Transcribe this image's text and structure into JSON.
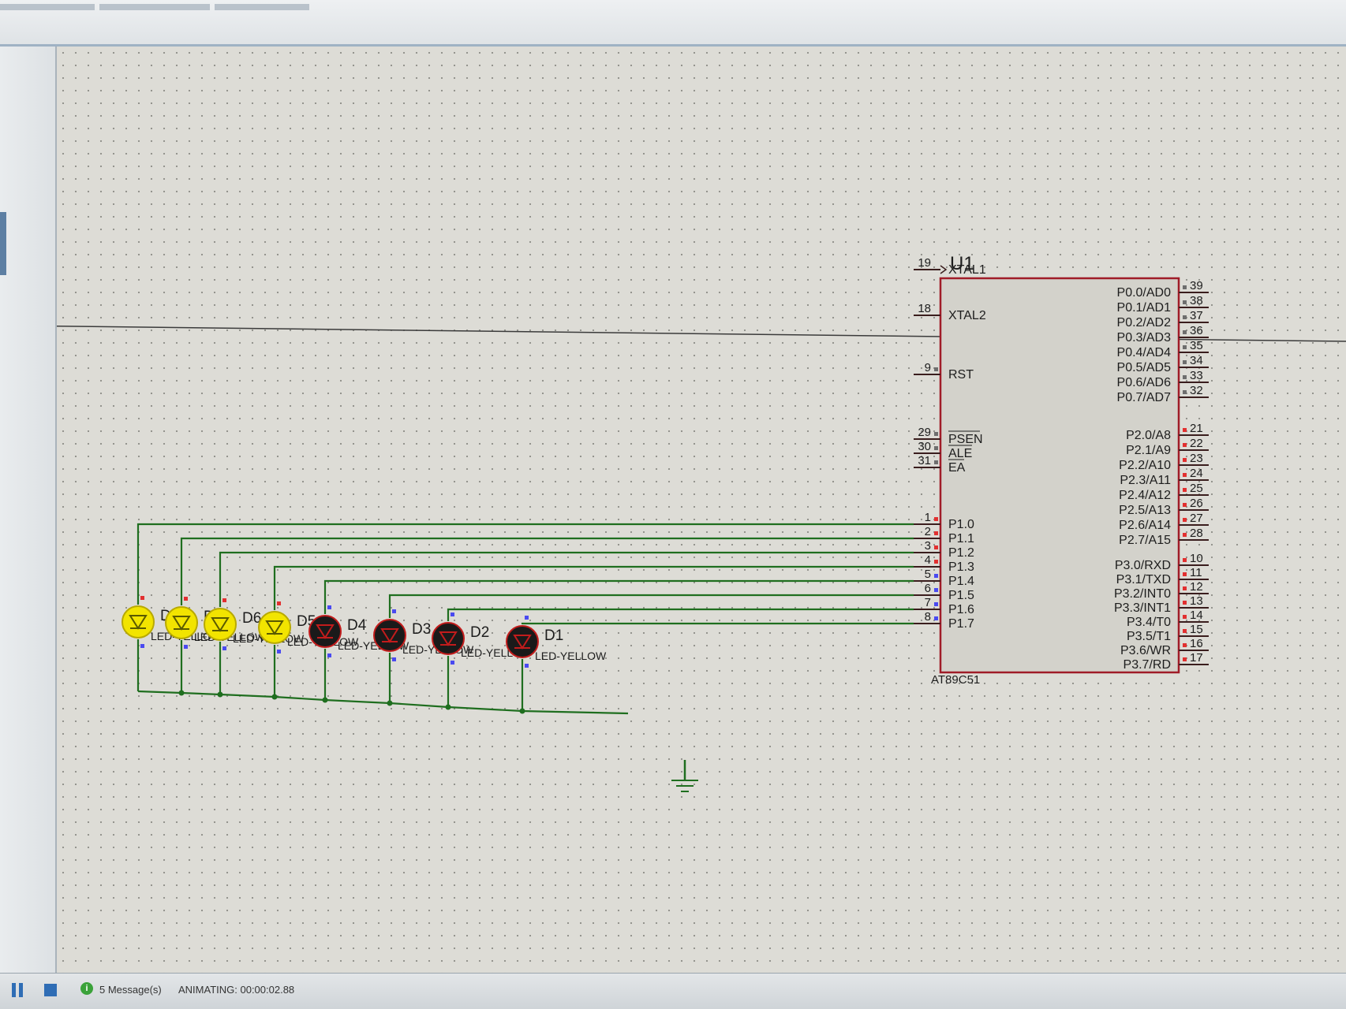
{
  "status_bar": {
    "messages": "5 Message(s)",
    "animating": "ANIMATING: 00:00:02.88"
  },
  "schematic": {
    "ic": {
      "ref": "U1",
      "part": "AT89C51",
      "left_pins": [
        {
          "num": "19",
          "name": "XTAL1"
        },
        {
          "num": "18",
          "name": "XTAL2"
        },
        {
          "num": "9",
          "name": "RST"
        },
        {
          "num": "29",
          "name": "PSEN"
        },
        {
          "num": "30",
          "name": "ALE"
        },
        {
          "num": "31",
          "name": "EA"
        },
        {
          "num": "1",
          "name": "P1.0"
        },
        {
          "num": "2",
          "name": "P1.1"
        },
        {
          "num": "3",
          "name": "P1.2"
        },
        {
          "num": "4",
          "name": "P1.3"
        },
        {
          "num": "5",
          "name": "P1.4"
        },
        {
          "num": "6",
          "name": "P1.5"
        },
        {
          "num": "7",
          "name": "P1.6"
        },
        {
          "num": "8",
          "name": "P1.7"
        }
      ],
      "right_pins": [
        {
          "num": "39",
          "name": "P0.0/AD0"
        },
        {
          "num": "38",
          "name": "P0.1/AD1"
        },
        {
          "num": "37",
          "name": "P0.2/AD2"
        },
        {
          "num": "36",
          "name": "P0.3/AD3"
        },
        {
          "num": "35",
          "name": "P0.4/AD4"
        },
        {
          "num": "34",
          "name": "P0.5/AD5"
        },
        {
          "num": "33",
          "name": "P0.6/AD6"
        },
        {
          "num": "32",
          "name": "P0.7/AD7"
        },
        {
          "num": "21",
          "name": "P2.0/A8"
        },
        {
          "num": "22",
          "name": "P2.1/A9"
        },
        {
          "num": "23",
          "name": "P2.2/A10"
        },
        {
          "num": "24",
          "name": "P2.3/A11"
        },
        {
          "num": "25",
          "name": "P2.4/A12"
        },
        {
          "num": "26",
          "name": "P2.5/A13"
        },
        {
          "num": "27",
          "name": "P2.6/A14"
        },
        {
          "num": "28",
          "name": "P2.7/A15"
        },
        {
          "num": "10",
          "name": "P3.0/RXD"
        },
        {
          "num": "11",
          "name": "P3.1/TXD"
        },
        {
          "num": "12",
          "name": "P3.2/INT0"
        },
        {
          "num": "13",
          "name": "P3.3/INT1"
        },
        {
          "num": "14",
          "name": "P3.4/T0"
        },
        {
          "num": "15",
          "name": "P3.5/T1"
        },
        {
          "num": "16",
          "name": "P3.6/WR"
        },
        {
          "num": "17",
          "name": "P3.7/RD"
        }
      ]
    },
    "leds": [
      {
        "ref": "D8",
        "value": "LED-YELLOW",
        "state": "on"
      },
      {
        "ref": "D7",
        "value": "LED-YELLOW",
        "state": "on"
      },
      {
        "ref": "D6",
        "value": "LED-YELLOW",
        "state": "on"
      },
      {
        "ref": "D5",
        "value": "LED-YELLOW",
        "state": "on"
      },
      {
        "ref": "D4",
        "value": "LED-YELLOW",
        "state": "off"
      },
      {
        "ref": "D3",
        "value": "LED-YELLOW",
        "state": "off"
      },
      {
        "ref": "D2",
        "value": "LED-YELLOW",
        "state": "off"
      },
      {
        "ref": "D1",
        "value": "LED-YELLOW",
        "state": "off"
      }
    ],
    "colors": {
      "wire": "#1f6e1f",
      "ic_border": "#a01c28",
      "ic_fill": "#d3d2cb",
      "led_on": "#f2e400",
      "led_off": "#1a1a1a",
      "led_outline": "#c21c1c",
      "pin_low": "#e23030",
      "pin_float": "#4a4af0",
      "pin_grey": "#6e6e6e"
    }
  }
}
